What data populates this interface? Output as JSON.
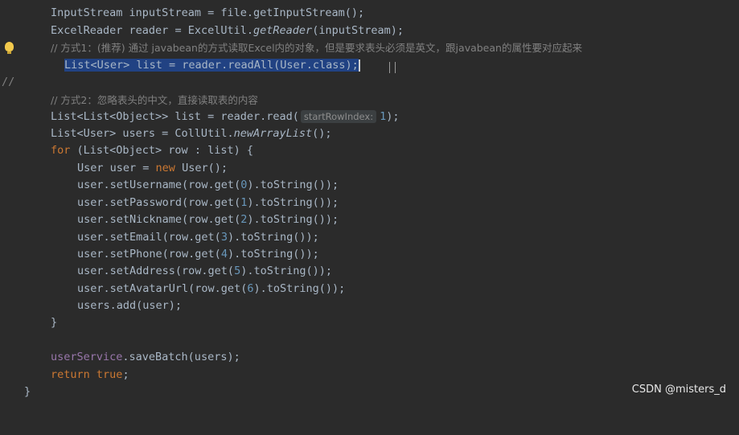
{
  "editor": {
    "line1": {
      "type": "InputStream",
      "var": "inputStream",
      "eq": "=",
      "call": "file.getInputStream();"
    },
    "line2": {
      "type": "ExcelReader",
      "var": "reader",
      "eq": "=",
      "prefix": "ExcelUtil.",
      "method": "getReader",
      "args": "(inputStream);"
    },
    "line3_comment": "// 方式1：(推荐) 通过 javabean的方式读取Excel内的对象，但是要求表头必须是英文，跟javabean的属性要对应起来",
    "line4_gutter": "//",
    "line4_selected": "List<User> list = reader.readAll(User.class);",
    "line6_comment": "// 方式2：忽略表头的中文，直接读取表的内容",
    "line7": {
      "pre": "List<List<Object>> list = reader.read(",
      "hint": "startRowIndex:",
      "num": "1",
      "post": ");"
    },
    "line8": {
      "pre": "List<User> users = CollUtil.",
      "method": "newArrayList",
      "post": "();"
    },
    "line9": {
      "kw": "for",
      "rest": " (List<Object> row : list) {"
    },
    "line10": {
      "pre": "User user = ",
      "kw": "new",
      "post": " User();"
    },
    "setters": [
      {
        "pre": "user.setUsername(row.get(",
        "idx": "0",
        "post": ").toString());"
      },
      {
        "pre": "user.setPassword(row.get(",
        "idx": "1",
        "post": ").toString());"
      },
      {
        "pre": "user.setNickname(row.get(",
        "idx": "2",
        "post": ").toString());"
      },
      {
        "pre": "user.setEmail(row.get(",
        "idx": "3",
        "post": ").toString());"
      },
      {
        "pre": "user.setPhone(row.get(",
        "idx": "4",
        "post": ").toString());"
      },
      {
        "pre": "user.setAddress(row.get(",
        "idx": "5",
        "post": ").toString());"
      },
      {
        "pre": "user.setAvatarUrl(row.get(",
        "idx": "6",
        "post": ").toString());"
      }
    ],
    "line18": "users.add(user);",
    "line19": "}",
    "line21": {
      "field": "userService",
      "rest": ".saveBatch(users);"
    },
    "line22": {
      "kw": "return",
      "val": "true",
      "end": ";"
    },
    "line23": "}"
  },
  "watermark": "CSDN @misters_d",
  "colors": {
    "background": "#2b2b2b",
    "keyword": "#cc7832",
    "selection": "#214283",
    "comment": "#808080",
    "number": "#6897bb"
  }
}
